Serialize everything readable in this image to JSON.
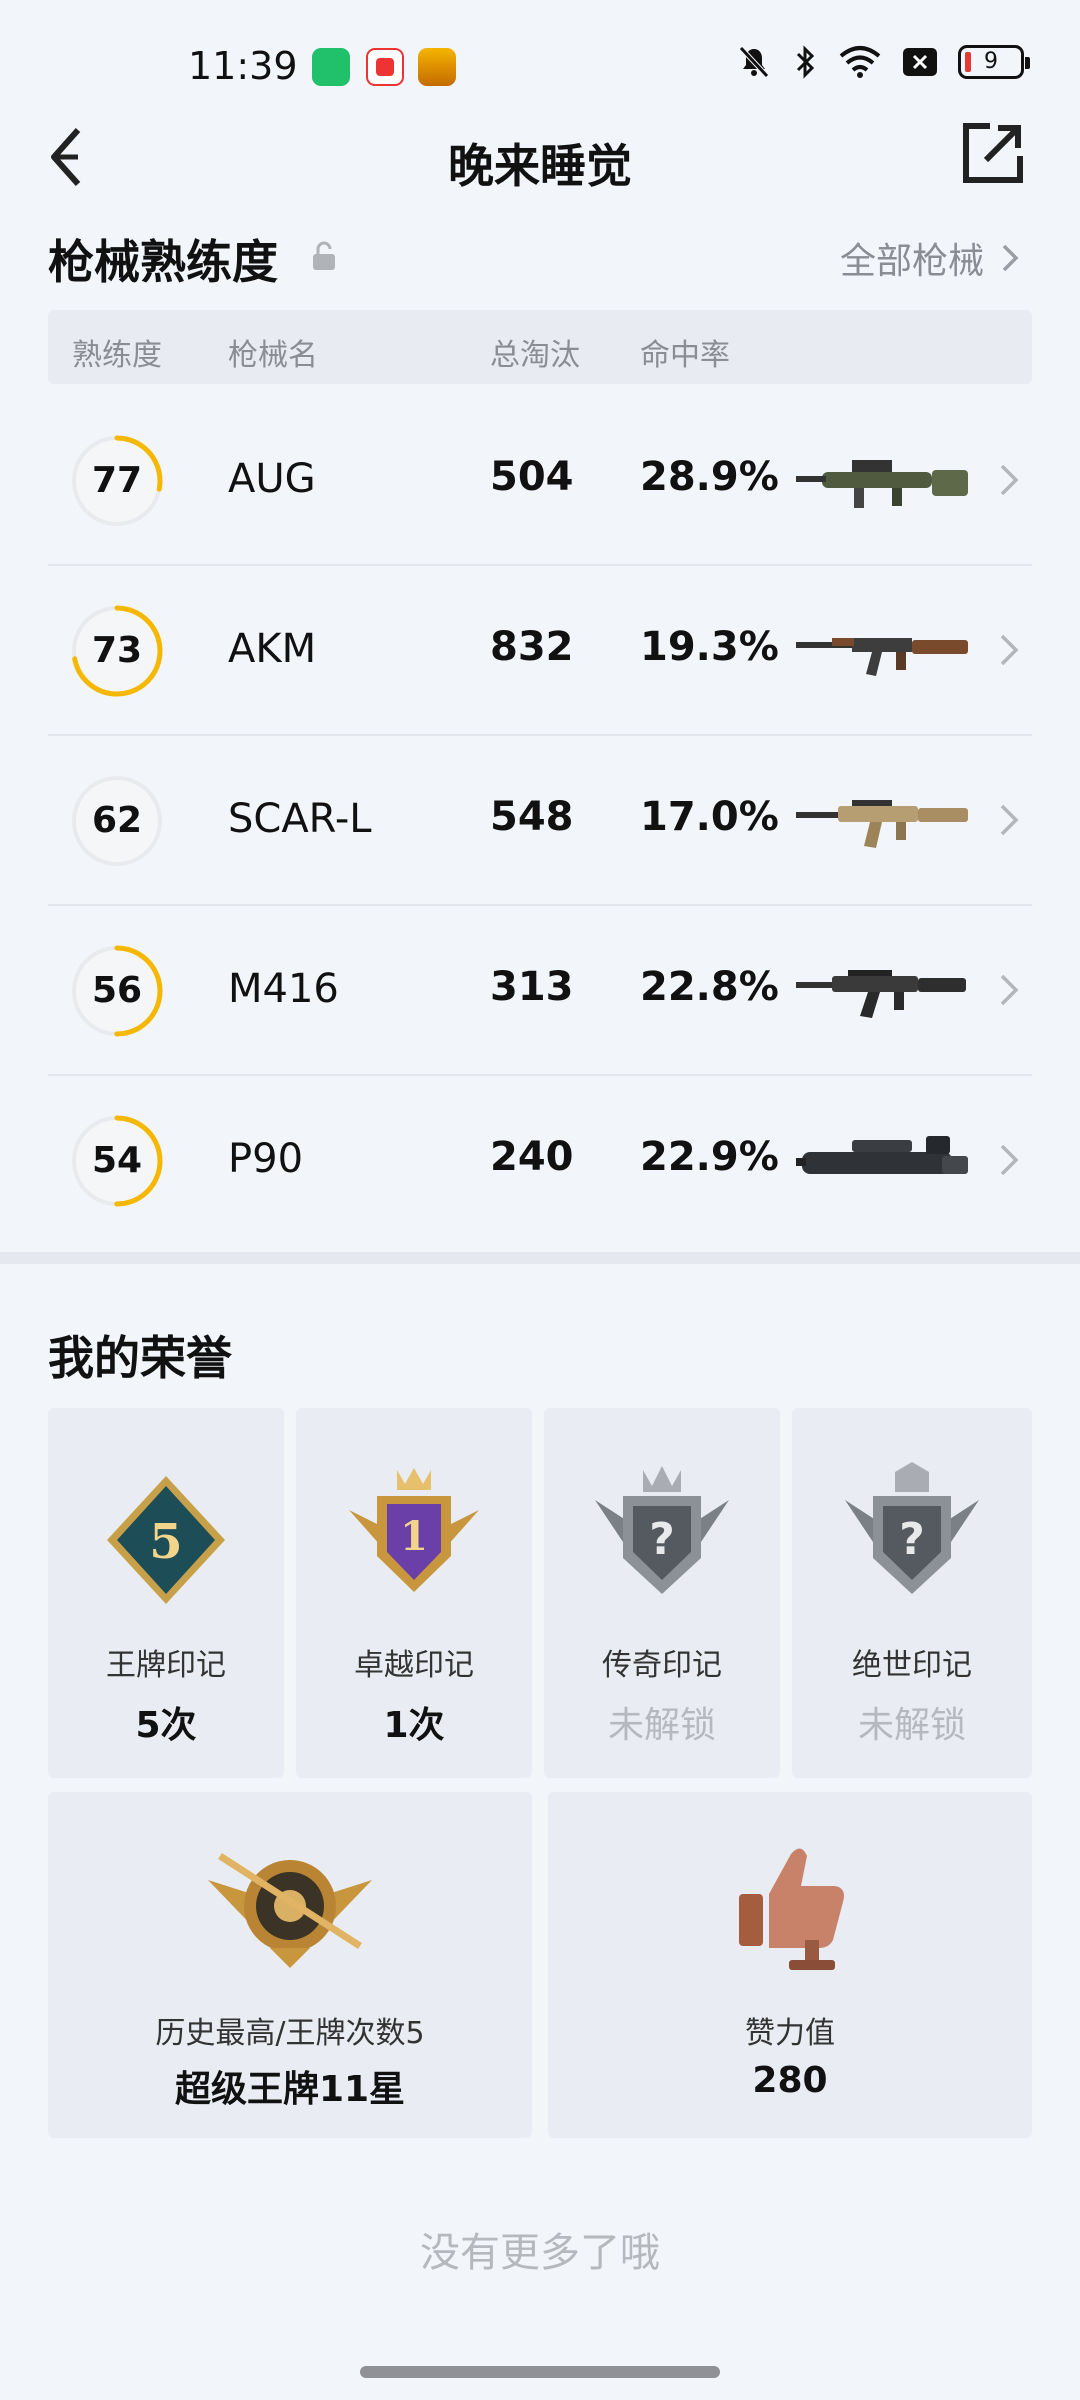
{
  "status_bar": {
    "time": "11:39",
    "battery": "9"
  },
  "nav": {
    "title": "晚来睡觉"
  },
  "weapons_section": {
    "title": "枪械熟练度",
    "all_link": "全部枪械",
    "headers": {
      "proficiency": "熟练度",
      "name": "枪械名",
      "kills": "总淘汰",
      "hit_rate": "命中率"
    },
    "rows": [
      {
        "proficiency": "77",
        "progress": 0.28,
        "name": "AUG",
        "kills": "504",
        "hit_rate": "28.9%",
        "icon": "aug-rifle-icon"
      },
      {
        "proficiency": "73",
        "progress": 0.72,
        "name": "AKM",
        "kills": "832",
        "hit_rate": "19.3%",
        "icon": "akm-rifle-icon"
      },
      {
        "proficiency": "62",
        "progress": 0.0,
        "name": "SCAR-L",
        "kills": "548",
        "hit_rate": "17.0%",
        "icon": "scar-l-rifle-icon"
      },
      {
        "proficiency": "56",
        "progress": 0.5,
        "name": "M416",
        "kills": "313",
        "hit_rate": "22.8%",
        "icon": "m416-rifle-icon"
      },
      {
        "proficiency": "54",
        "progress": 0.5,
        "name": "P90",
        "kills": "240",
        "hit_rate": "22.9%",
        "icon": "p90-smg-icon"
      }
    ]
  },
  "honors_section": {
    "title": "我的荣誉",
    "marks": [
      {
        "label": "王牌印记",
        "value": "5次",
        "locked": false,
        "icon": "ace-mark-badge-icon"
      },
      {
        "label": "卓越印记",
        "value": "1次",
        "locked": false,
        "icon": "excellence-mark-badge-icon"
      },
      {
        "label": "传奇印记",
        "value": "未解锁",
        "locked": true,
        "icon": "legend-mark-locked-icon"
      },
      {
        "label": "绝世印记",
        "value": "未解锁",
        "locked": true,
        "icon": "peerless-mark-locked-icon"
      }
    ],
    "highest": {
      "label": "历史最高/王牌次数5",
      "value": "超级王牌11星",
      "icon": "super-ace-tier-badge-icon"
    },
    "likes": {
      "label": "赞力值",
      "value": "280",
      "icon": "thumbs-up-trophy-icon"
    }
  },
  "footer": {
    "note": "没有更多了哦"
  },
  "colors": {
    "ring_progress": "#f5b700",
    "ring_track": "#e8eaee",
    "background": "#f2f5fa",
    "card": "#e9edf3",
    "muted": "#8a8d93"
  }
}
